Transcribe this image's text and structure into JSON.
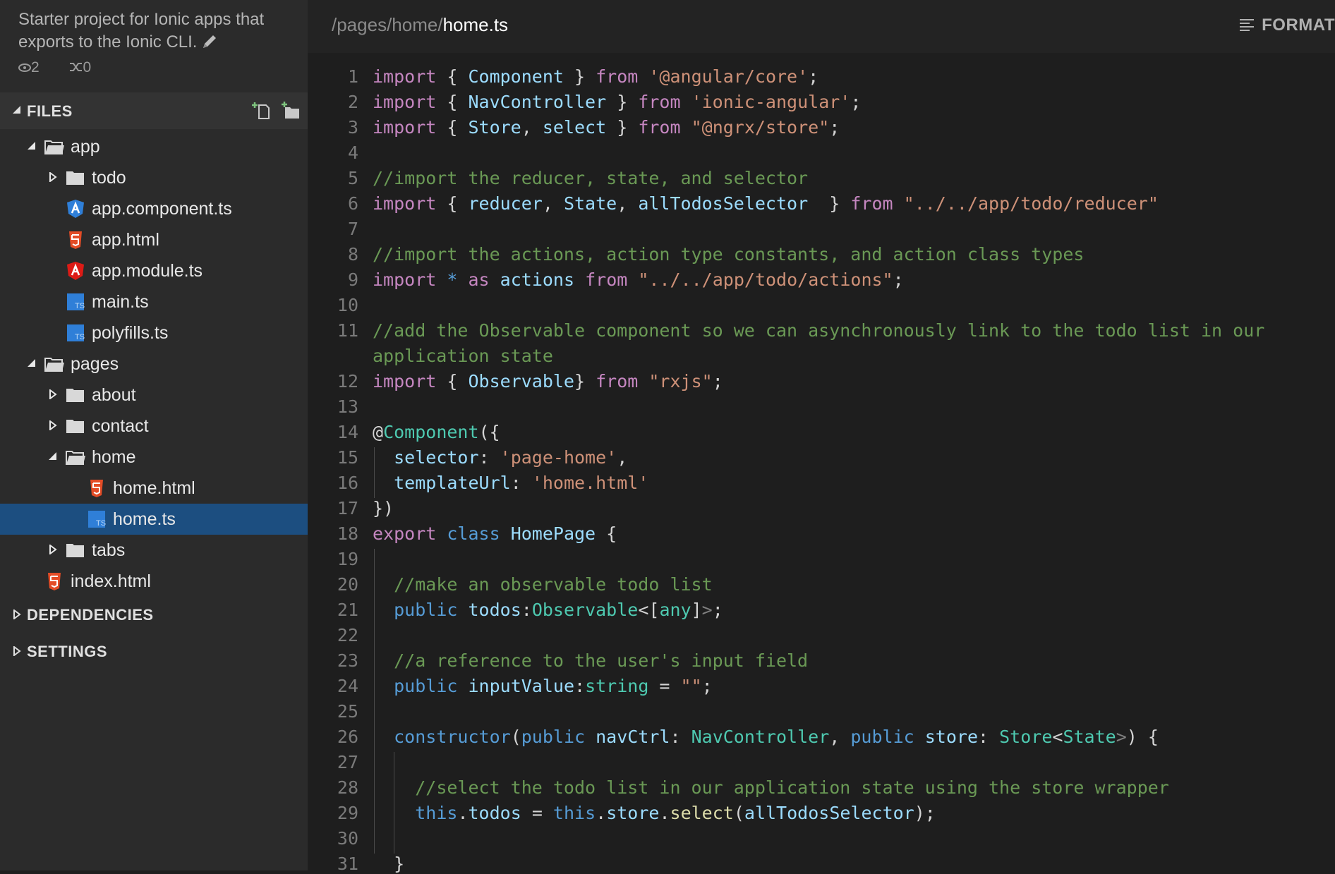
{
  "sidebar": {
    "description": "Starter project for Ionic apps that exports to the Ionic CLI.",
    "stats": {
      "views": "2",
      "forks": "0"
    },
    "files_header": "FILES",
    "tree": [
      {
        "label": "app",
        "type": "folder",
        "expanded": true,
        "depth": 0
      },
      {
        "label": "todo",
        "type": "folder",
        "expanded": false,
        "depth": 1
      },
      {
        "label": "app.component.ts",
        "type": "angular-blue",
        "depth": 1
      },
      {
        "label": "app.html",
        "type": "html5",
        "depth": 1
      },
      {
        "label": "app.module.ts",
        "type": "angular-red",
        "depth": 1
      },
      {
        "label": "main.ts",
        "type": "ts",
        "depth": 1
      },
      {
        "label": "polyfills.ts",
        "type": "ts",
        "depth": 1
      },
      {
        "label": "pages",
        "type": "folder",
        "expanded": true,
        "depth": 0
      },
      {
        "label": "about",
        "type": "folder",
        "expanded": false,
        "depth": 1
      },
      {
        "label": "contact",
        "type": "folder",
        "expanded": false,
        "depth": 1
      },
      {
        "label": "home",
        "type": "folder",
        "expanded": true,
        "depth": 1
      },
      {
        "label": "home.html",
        "type": "html5",
        "depth": 2
      },
      {
        "label": "home.ts",
        "type": "ts",
        "depth": 2,
        "selected": true
      },
      {
        "label": "tabs",
        "type": "folder",
        "expanded": false,
        "depth": 1
      },
      {
        "label": "index.html",
        "type": "html5",
        "depth": 0
      }
    ],
    "dependencies_header": "DEPENDENCIES",
    "settings_header": "SETTINGS"
  },
  "editor": {
    "breadcrumb_path": "/pages/home/",
    "breadcrumb_file": "home.ts",
    "format_label": "FORMAT",
    "line_numbers": [
      "1",
      "2",
      "3",
      "4",
      "5",
      "6",
      "7",
      "8",
      "9",
      "10",
      "11",
      "",
      "12",
      "13",
      "14",
      "15",
      "16",
      "17",
      "18",
      "19",
      "20",
      "21",
      "22",
      "23",
      "24",
      "25",
      "26",
      "27",
      "28",
      "29",
      "30",
      "31"
    ],
    "lines": [
      [
        [
          "k",
          "import"
        ],
        [
          "p",
          " { "
        ],
        [
          "i",
          "Component"
        ],
        [
          "p",
          " } "
        ],
        [
          "k",
          "from"
        ],
        [
          "p",
          " "
        ],
        [
          "s",
          "'@angular/core'"
        ],
        [
          "p",
          ";"
        ]
      ],
      [
        [
          "k",
          "import"
        ],
        [
          "p",
          " { "
        ],
        [
          "i",
          "NavController"
        ],
        [
          "p",
          " } "
        ],
        [
          "k",
          "from"
        ],
        [
          "p",
          " "
        ],
        [
          "s",
          "'ionic-angular'"
        ],
        [
          "p",
          ";"
        ]
      ],
      [
        [
          "k",
          "import"
        ],
        [
          "p",
          " { "
        ],
        [
          "i",
          "Store"
        ],
        [
          "p",
          ", "
        ],
        [
          "i",
          "select"
        ],
        [
          "p",
          " } "
        ],
        [
          "k",
          "from"
        ],
        [
          "p",
          " "
        ],
        [
          "s",
          "\"@ngrx/store\""
        ],
        [
          "p",
          ";"
        ]
      ],
      [],
      [
        [
          "c",
          "//import the reducer, state, and selector"
        ]
      ],
      [
        [
          "k",
          "import"
        ],
        [
          "p",
          " { "
        ],
        [
          "i",
          "reducer"
        ],
        [
          "p",
          ", "
        ],
        [
          "i",
          "State"
        ],
        [
          "p",
          ", "
        ],
        [
          "i",
          "allTodosSelector"
        ],
        [
          "p",
          "  } "
        ],
        [
          "k",
          "from"
        ],
        [
          "p",
          " "
        ],
        [
          "s",
          "\"../../app/todo/reducer\""
        ]
      ],
      [],
      [
        [
          "c",
          "//import the actions, action type constants, and action class types"
        ]
      ],
      [
        [
          "k",
          "import"
        ],
        [
          "p",
          " "
        ],
        [
          "kb",
          "*"
        ],
        [
          "p",
          " "
        ],
        [
          "k",
          "as"
        ],
        [
          "p",
          " "
        ],
        [
          "i",
          "actions"
        ],
        [
          "p",
          " "
        ],
        [
          "k",
          "from"
        ],
        [
          "p",
          " "
        ],
        [
          "s",
          "\"../../app/todo/actions\""
        ],
        [
          "p",
          ";"
        ]
      ],
      [],
      [
        [
          "c",
          "//add the Observable component so we can asynchronously link to the todo list in our"
        ]
      ],
      [
        [
          "c",
          "application state"
        ]
      ],
      [
        [
          "k",
          "import"
        ],
        [
          "p",
          " { "
        ],
        [
          "i",
          "Observable"
        ],
        [
          "p",
          "} "
        ],
        [
          "k",
          "from"
        ],
        [
          "p",
          " "
        ],
        [
          "s",
          "\"rxjs\""
        ],
        [
          "p",
          ";"
        ]
      ],
      [],
      [
        [
          "p",
          "@"
        ],
        [
          "t",
          "Component"
        ],
        [
          "p",
          "({"
        ]
      ],
      [
        [
          "p",
          "  "
        ],
        [
          "i",
          "selector"
        ],
        [
          "p",
          ": "
        ],
        [
          "s",
          "'page-home'"
        ],
        [
          "p",
          ","
        ]
      ],
      [
        [
          "p",
          "  "
        ],
        [
          "i",
          "templateUrl"
        ],
        [
          "p",
          ": "
        ],
        [
          "s",
          "'home.html'"
        ]
      ],
      [
        [
          "p",
          "})"
        ]
      ],
      [
        [
          "k",
          "export"
        ],
        [
          "p",
          " "
        ],
        [
          "kb",
          "class"
        ],
        [
          "p",
          " "
        ],
        [
          "i",
          "HomePage"
        ],
        [
          "p",
          " {"
        ]
      ],
      [],
      [
        [
          "p",
          "  "
        ],
        [
          "c",
          "//make an observable todo list"
        ]
      ],
      [
        [
          "p",
          "  "
        ],
        [
          "kb",
          "public"
        ],
        [
          "p",
          " "
        ],
        [
          "i",
          "todos"
        ],
        [
          "p",
          ":"
        ],
        [
          "t",
          "Observable"
        ],
        [
          "p",
          "<["
        ],
        [
          "t",
          "any"
        ],
        [
          "p",
          "]"
        ],
        [
          "d",
          ">"
        ],
        [
          "p",
          ";"
        ]
      ],
      [],
      [
        [
          "p",
          "  "
        ],
        [
          "c",
          "//a reference to the user's input field"
        ]
      ],
      [
        [
          "p",
          "  "
        ],
        [
          "kb",
          "public"
        ],
        [
          "p",
          " "
        ],
        [
          "i",
          "inputValue"
        ],
        [
          "p",
          ":"
        ],
        [
          "t",
          "string"
        ],
        [
          "p",
          " = "
        ],
        [
          "s",
          "\"\""
        ],
        [
          "p",
          ";"
        ]
      ],
      [],
      [
        [
          "p",
          "  "
        ],
        [
          "kb",
          "constructor"
        ],
        [
          "p",
          "("
        ],
        [
          "kb",
          "public"
        ],
        [
          "p",
          " "
        ],
        [
          "i",
          "navCtrl"
        ],
        [
          "p",
          ": "
        ],
        [
          "t",
          "NavController"
        ],
        [
          "p",
          ", "
        ],
        [
          "kb",
          "public"
        ],
        [
          "p",
          " "
        ],
        [
          "i",
          "store"
        ],
        [
          "p",
          ": "
        ],
        [
          "t",
          "Store"
        ],
        [
          "p",
          "<"
        ],
        [
          "t",
          "State"
        ],
        [
          "d",
          ">"
        ],
        [
          "p",
          ") {"
        ]
      ],
      [],
      [
        [
          "p",
          "    "
        ],
        [
          "c",
          "//select the todo list in our application state using the store wrapper"
        ]
      ],
      [
        [
          "p",
          "    "
        ],
        [
          "kb",
          "this"
        ],
        [
          "p",
          "."
        ],
        [
          "i",
          "todos"
        ],
        [
          "p",
          " = "
        ],
        [
          "kb",
          "this"
        ],
        [
          "p",
          "."
        ],
        [
          "i",
          "store"
        ],
        [
          "p",
          "."
        ],
        [
          "f",
          "select"
        ],
        [
          "p",
          "("
        ],
        [
          "i",
          "allTodosSelector"
        ],
        [
          "p",
          ");"
        ]
      ],
      [],
      [
        [
          "p",
          "  }"
        ]
      ]
    ]
  }
}
